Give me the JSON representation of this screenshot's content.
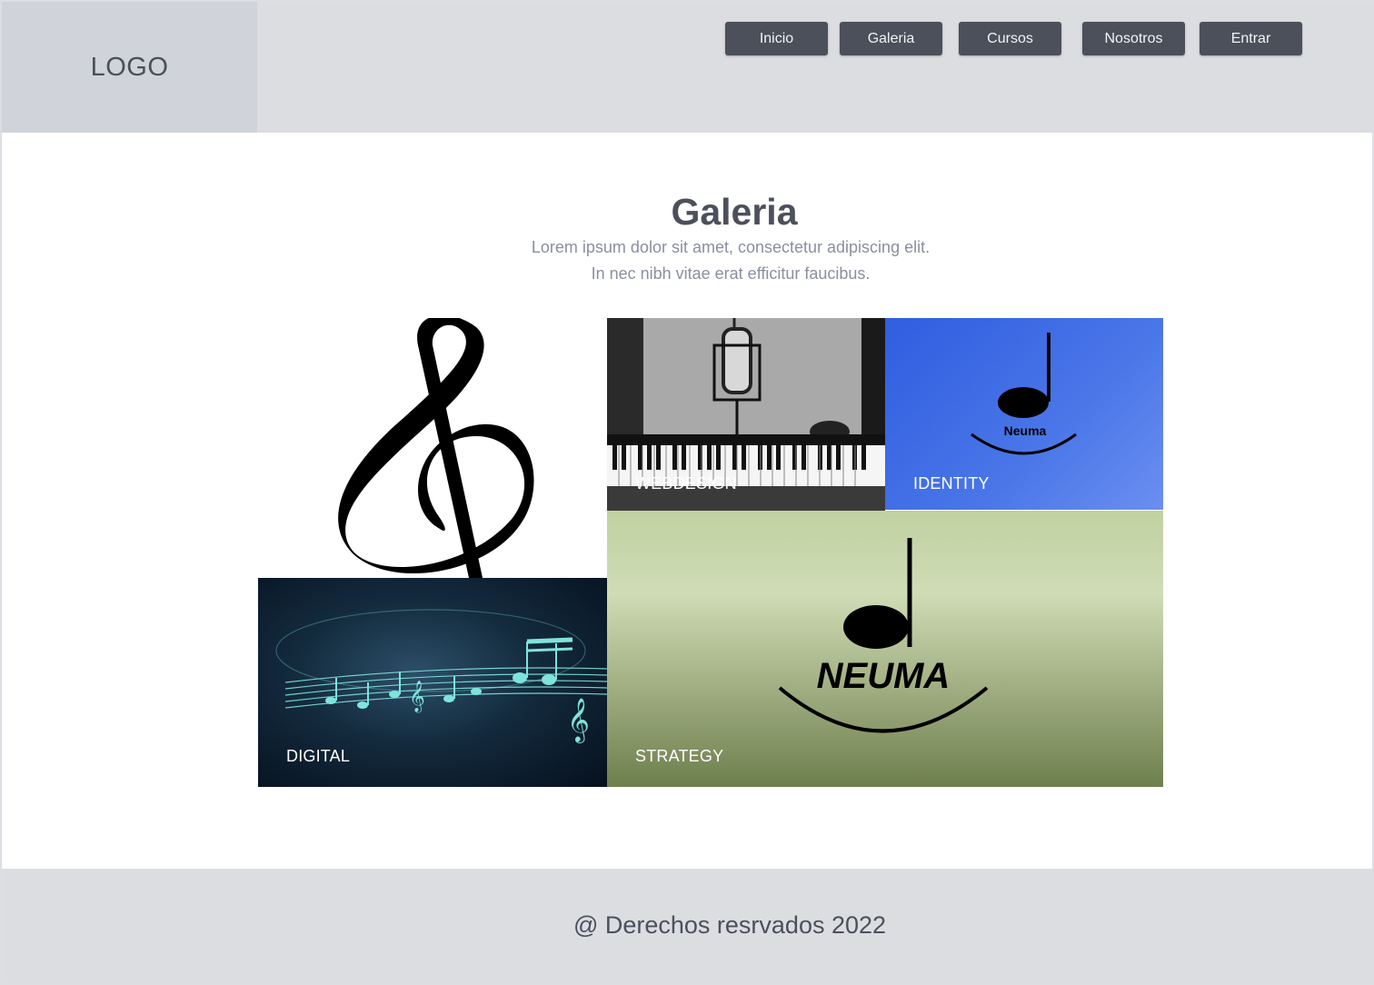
{
  "header": {
    "logo": "LOGO",
    "nav": [
      {
        "label": "Inicio"
      },
      {
        "label": "Galeria"
      },
      {
        "label": "Cursos"
      },
      {
        "label": "Nosotros"
      },
      {
        "label": "Entrar"
      }
    ]
  },
  "main": {
    "title": "Galeria",
    "subtitle_line1": "Lorem ipsum dolor sit amet, consectetur adipiscing elit.",
    "subtitle_line2": "In nec nibh vitae erat efficitur faucibus."
  },
  "gallery": [
    {
      "name": "treble-clef-image",
      "label": ""
    },
    {
      "name": "webdesign-image",
      "label": "WEBDESIGN"
    },
    {
      "name": "identity-image",
      "label": "IDENTITY",
      "logo_text": "Neuma"
    },
    {
      "name": "digital-image",
      "label": "DIGITAL"
    },
    {
      "name": "strategy-image",
      "label": "STRATEGY",
      "logo_text": "NEUMA"
    }
  ],
  "footer": {
    "text": "@ Derechos resrvados 2022"
  },
  "colors": {
    "header_bg": "#dcdde1",
    "logo_bg": "#d0d3d9",
    "nav_button": "#4b505b",
    "identity_blue": "#3a68e4",
    "strategy_green": "#a6b488"
  }
}
